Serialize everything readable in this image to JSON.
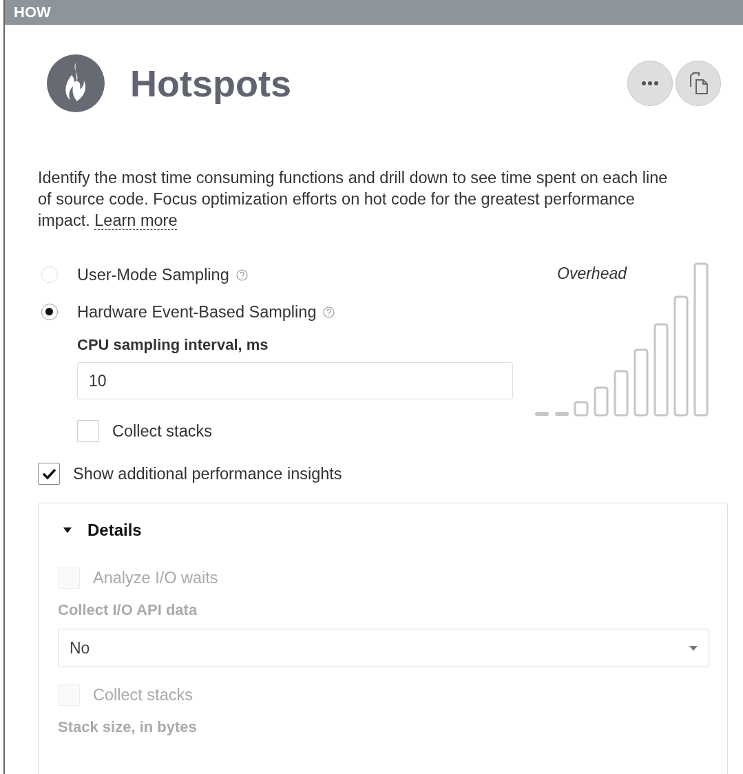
{
  "header": {
    "title": "HOW"
  },
  "analysis": {
    "title": "Hotspots",
    "description": "Identify the most time consuming functions and drill down to see time spent on each line of source code. Focus optimization efforts on hot code for the greatest performance impact.",
    "learn_more": "Learn more"
  },
  "sampling_modes": [
    {
      "label": "User-Mode Sampling",
      "selected": false
    },
    {
      "label": "Hardware Event-Based Sampling",
      "selected": true
    }
  ],
  "cpu_interval": {
    "label": "CPU sampling interval, ms",
    "value": "10"
  },
  "collect_stacks": {
    "label": "Collect stacks",
    "checked": false
  },
  "overhead": {
    "label": "Overhead"
  },
  "show_insights": {
    "label": "Show additional performance insights",
    "checked": true
  },
  "details": {
    "title": "Details",
    "expanded": true,
    "items": [
      {
        "kind": "checkbox",
        "label": "Analyze I/O waits",
        "checked": false,
        "disabled": true
      },
      {
        "kind": "label",
        "label": "Collect I/O API data",
        "disabled": true
      },
      {
        "kind": "select",
        "value": "No",
        "disabled": false
      },
      {
        "kind": "checkbox",
        "label": "Collect stacks",
        "checked": false,
        "disabled": true
      },
      {
        "kind": "label",
        "label": "Stack size, in bytes",
        "disabled": true
      }
    ]
  }
}
